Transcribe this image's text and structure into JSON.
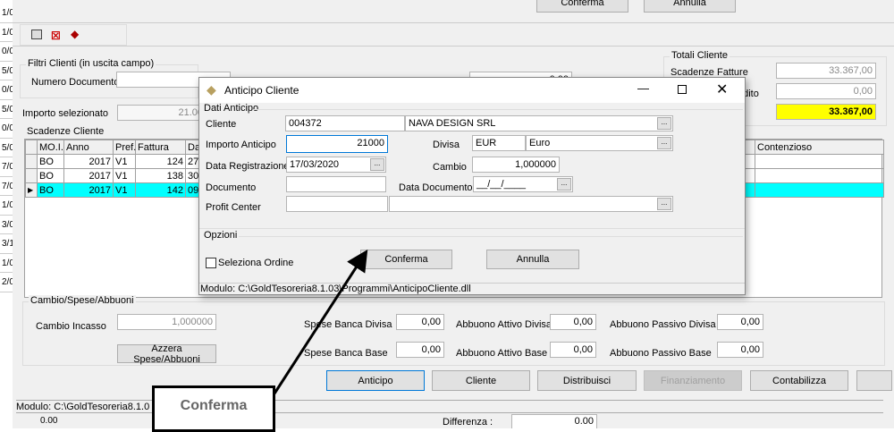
{
  "left_strip": [
    "1/0",
    "1/0",
    "0/0",
    "5/0",
    "0/0",
    "5/0",
    "0/0",
    "5/0",
    "7/0",
    "7/0",
    "1/0",
    "3/0",
    "3/1",
    "1/0",
    "2/0"
  ],
  "top_buttons": {
    "confirm": "Conferma",
    "cancel": "Annulla"
  },
  "filters": {
    "title": "Filtri Clienti (in uscita campo)",
    "numero_documento_label": "Numero Documento",
    "numero_documento_value": "",
    "hidden_value": "0,00"
  },
  "importo_selezionato": {
    "label": "Importo selezionato",
    "value": "21.00"
  },
  "scadenze": {
    "title": "Scadenze Cliente",
    "columns": [
      "MO.I.",
      "Anno",
      "Pref.",
      "Fattura",
      "Da",
      "Contenzioso"
    ],
    "rows": [
      [
        "BO",
        "2017",
        "V1",
        "124",
        "27/"
      ],
      [
        "BO",
        "2017",
        "V1",
        "138",
        "30/"
      ],
      [
        "BO",
        "2017",
        "V1",
        "142",
        "09/"
      ]
    ],
    "selected_row": 2
  },
  "totali": {
    "title": "Totali Cliente",
    "scadenze_fatture_label": "Scadenze Fatture",
    "scadenze_fatture": "33.367,00",
    "row2_label": "edito",
    "row2_value": "0,00",
    "total": "33.367,00"
  },
  "dialog": {
    "title": "Anticipo Cliente",
    "section": "Dati Anticipo",
    "cliente_label": "Cliente",
    "cliente_code": "004372",
    "cliente_name": "NAVA DESIGN SRL",
    "importo_label": "Importo Anticipo",
    "importo": "21000",
    "divisa_label": "Divisa",
    "divisa_code": "EUR",
    "divisa_name": "Euro",
    "data_reg_label": "Data Registrazione",
    "data_reg": "17/03/2020",
    "cambio_label": "Cambio",
    "cambio": "1,000000",
    "documento_label": "Documento",
    "documento": "",
    "data_doc_label": "Data Documento",
    "data_doc": "__/__/____",
    "profit_label": "Profit Center",
    "options_title": "Opzioni",
    "seleziona_ordine": "Seleziona Ordine",
    "confirm": "Conferma",
    "cancel": "Annulla",
    "status": "Modulo: C:\\GoldTesoreria8.1.03\\Programmi\\AnticipoCliente.dll",
    "dots": "..."
  },
  "spese": {
    "title": "Cambio/Spese/Abbuoni",
    "cambio_incasso_label": "Cambio Incasso",
    "cambio_incasso": "1,000000",
    "azzera": "Azzera Spese/Abbuoni",
    "sbd_label": "Spese Banca Divisa",
    "sbd": "0,00",
    "sbb_label": "Spese Banca Base",
    "sbb": "0,00",
    "aad_label": "Abbuono Attivo Divisa",
    "aad": "0,00",
    "aab_label": "Abbuono Attivo Base",
    "aab": "0,00",
    "apd_label": "Abbuono Passivo Divisa",
    "apd": "0,00",
    "apb_label": "Abbuono Passivo Base",
    "apb": "0,00"
  },
  "actions": [
    "Anticipo",
    "Cliente",
    "Distribuisci",
    "Finanziamento",
    "Contabilizza"
  ],
  "status": "Modulo: C:\\GoldTesoreria8.1.0",
  "bottom": {
    "left_value": "0.00",
    "differenza_label": "Differenza :",
    "differenza": "0.00"
  },
  "callout": "Conferma"
}
